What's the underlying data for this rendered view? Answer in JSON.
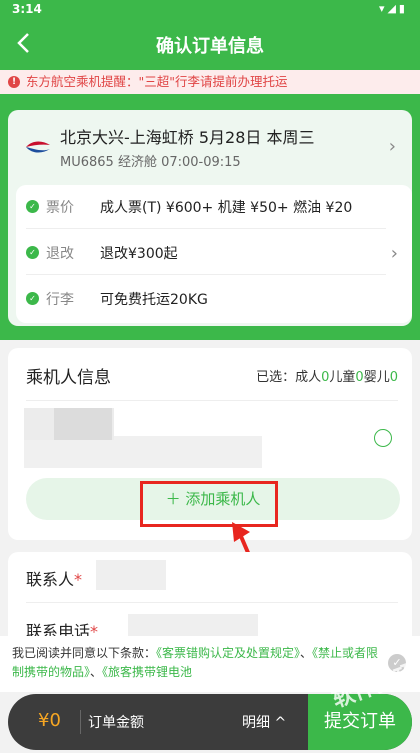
{
  "status_bar": {
    "time": "3:14",
    "icons": "▾◢▮"
  },
  "header": {
    "title": "确认订单信息",
    "back_icon": "chevron-left-icon"
  },
  "notice": {
    "text": "东方航空乘机提醒：\"三超\"行李请提前办理托运"
  },
  "flight": {
    "route": "北京大兴-上海虹桥 5月28日  本周三",
    "sub": "MU6865 经济舱 07:00-09:15",
    "rows": [
      {
        "key": "票价",
        "value": "成人票(T) ¥600+ 机建 ¥50+ 燃油 ¥20"
      },
      {
        "key": "退改",
        "value": "退改¥300起"
      },
      {
        "key": "行李",
        "value": "可免费托运20KG"
      }
    ]
  },
  "passenger": {
    "title": "乘机人信息",
    "selected_prefix": "已选：成人",
    "adult": "0",
    "child_label": "儿童",
    "child": "0",
    "infant_label": "婴儿",
    "infant": "0",
    "add_label": "＋ 添加乘机人"
  },
  "contact": {
    "name_label": "联系人",
    "phone_label": "联系电话",
    "required": "*"
  },
  "terms": {
    "prefix": "我已阅读并同意以下条款：",
    "link1": "《客票错购认定及处置规定》",
    "sep1": "、",
    "link2": "《禁止或者限制携带的物品》",
    "sep2": "、",
    "link3": "《旅客携带锂电池"
  },
  "bottom": {
    "amount": "¥0",
    "amount_label": "订单金额",
    "details_label": "明细 ^",
    "submit_label": "提交订单"
  },
  "watermark": "软件技巧",
  "colors": {
    "accent": "#3cb84a",
    "warning": "#e04545",
    "highlight": "#e8261f",
    "amount": "#f6a623"
  }
}
